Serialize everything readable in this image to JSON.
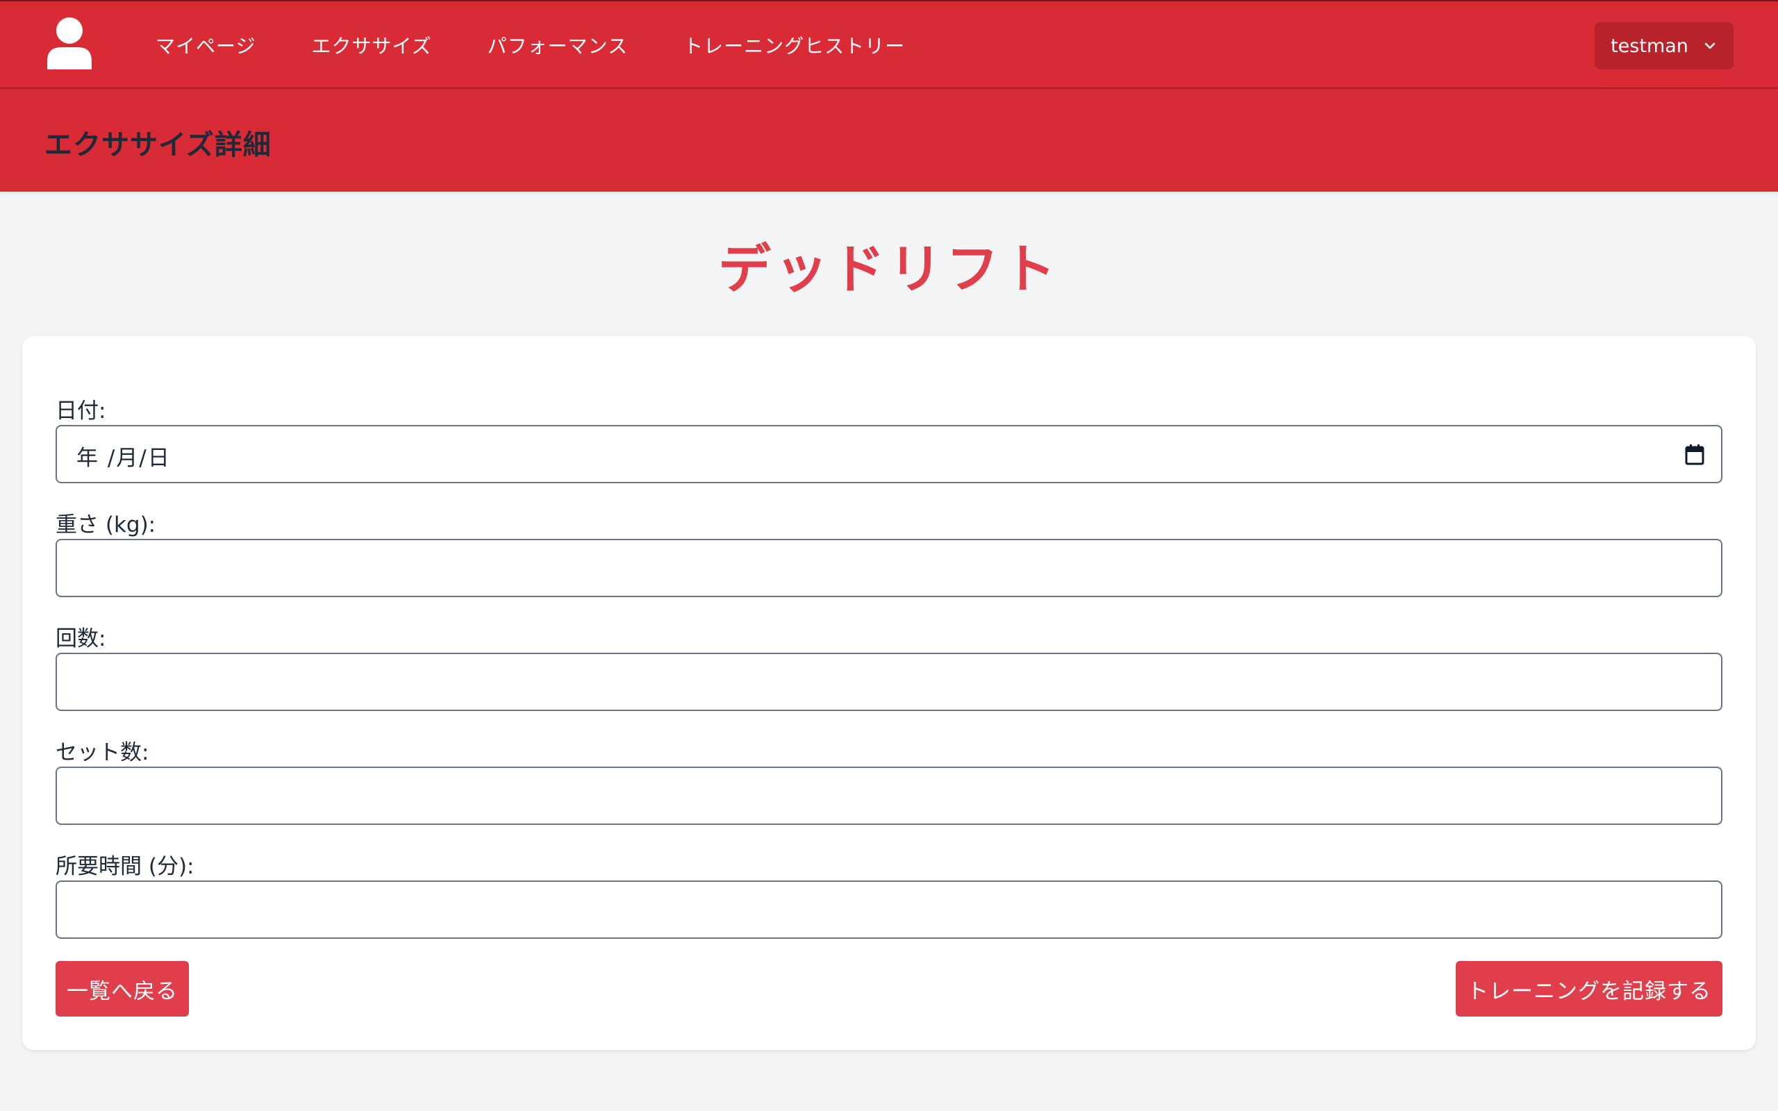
{
  "nav": {
    "items": [
      {
        "label": "マイページ"
      },
      {
        "label": "エクササイズ"
      },
      {
        "label": "パフォーマンス"
      },
      {
        "label": "トレーニングヒストリー"
      }
    ],
    "user": {
      "name": "testman"
    }
  },
  "header": {
    "title": "エクササイズ詳細"
  },
  "exercise": {
    "name": "デッドリフト"
  },
  "form": {
    "date": {
      "label": "日付:",
      "value": "年 /月/日"
    },
    "weight": {
      "label": "重さ (kg):",
      "value": ""
    },
    "reps": {
      "label": "回数:",
      "value": ""
    },
    "sets": {
      "label": "セット数:",
      "value": ""
    },
    "duration": {
      "label": "所要時間 (分):",
      "value": ""
    }
  },
  "buttons": {
    "back": "一覧へ戻る",
    "submit": "トレーニングを記録する"
  },
  "colors": {
    "brand_red": "#d92b35",
    "accent_red": "#e03e4b",
    "background": "#f3f4f6"
  }
}
